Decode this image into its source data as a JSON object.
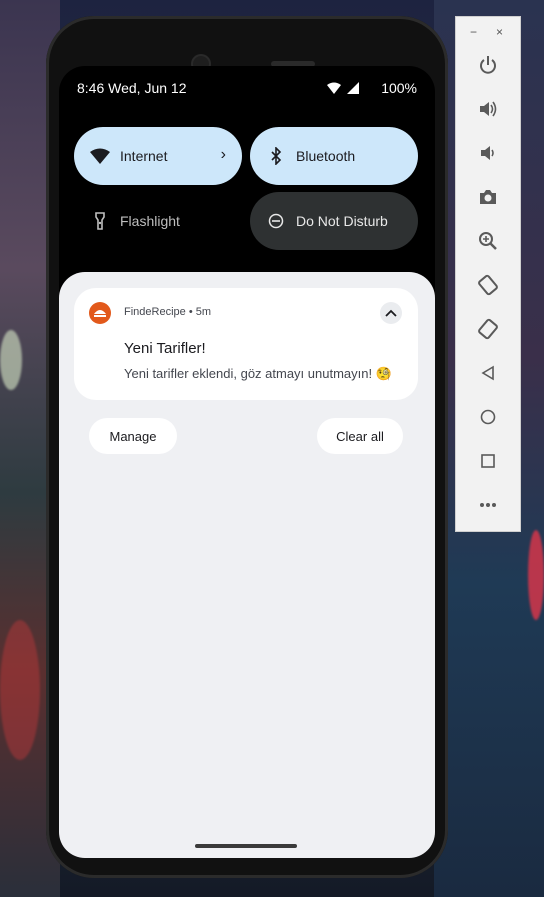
{
  "status_bar": {
    "time_date": "8:46 Wed, Jun 12",
    "battery": "100%"
  },
  "quick_settings": {
    "tiles": [
      {
        "label": "Internet",
        "state": "on",
        "icon": "wifi-icon"
      },
      {
        "label": "Bluetooth",
        "state": "on",
        "icon": "bluetooth-icon"
      },
      {
        "label": "Flashlight",
        "state": "off",
        "icon": "flashlight-icon"
      },
      {
        "label": "Do Not Disturb",
        "state": "active",
        "icon": "do-not-disturb-icon"
      }
    ]
  },
  "notification": {
    "app_name": "FindeRecipe",
    "time": "5m",
    "title": "Yeni Tarifler!",
    "text": "Yeni tarifler eklendi, göz atmayı unutmayın! 🧐"
  },
  "actions": {
    "manage": "Manage",
    "clear_all": "Clear all"
  },
  "emulator_toolbar": {
    "icons": [
      "minimize-icon",
      "close-icon",
      "power-icon",
      "volume-up-icon",
      "volume-down-icon",
      "camera-icon",
      "zoom-icon",
      "rotate-left-icon",
      "rotate-right-icon",
      "back-icon",
      "home-icon",
      "overview-icon",
      "more-icon"
    ]
  },
  "colors": {
    "accent_tile": "#cde7fa",
    "shade_bg": "#eff0f3",
    "app_icon": "#e2591b"
  }
}
